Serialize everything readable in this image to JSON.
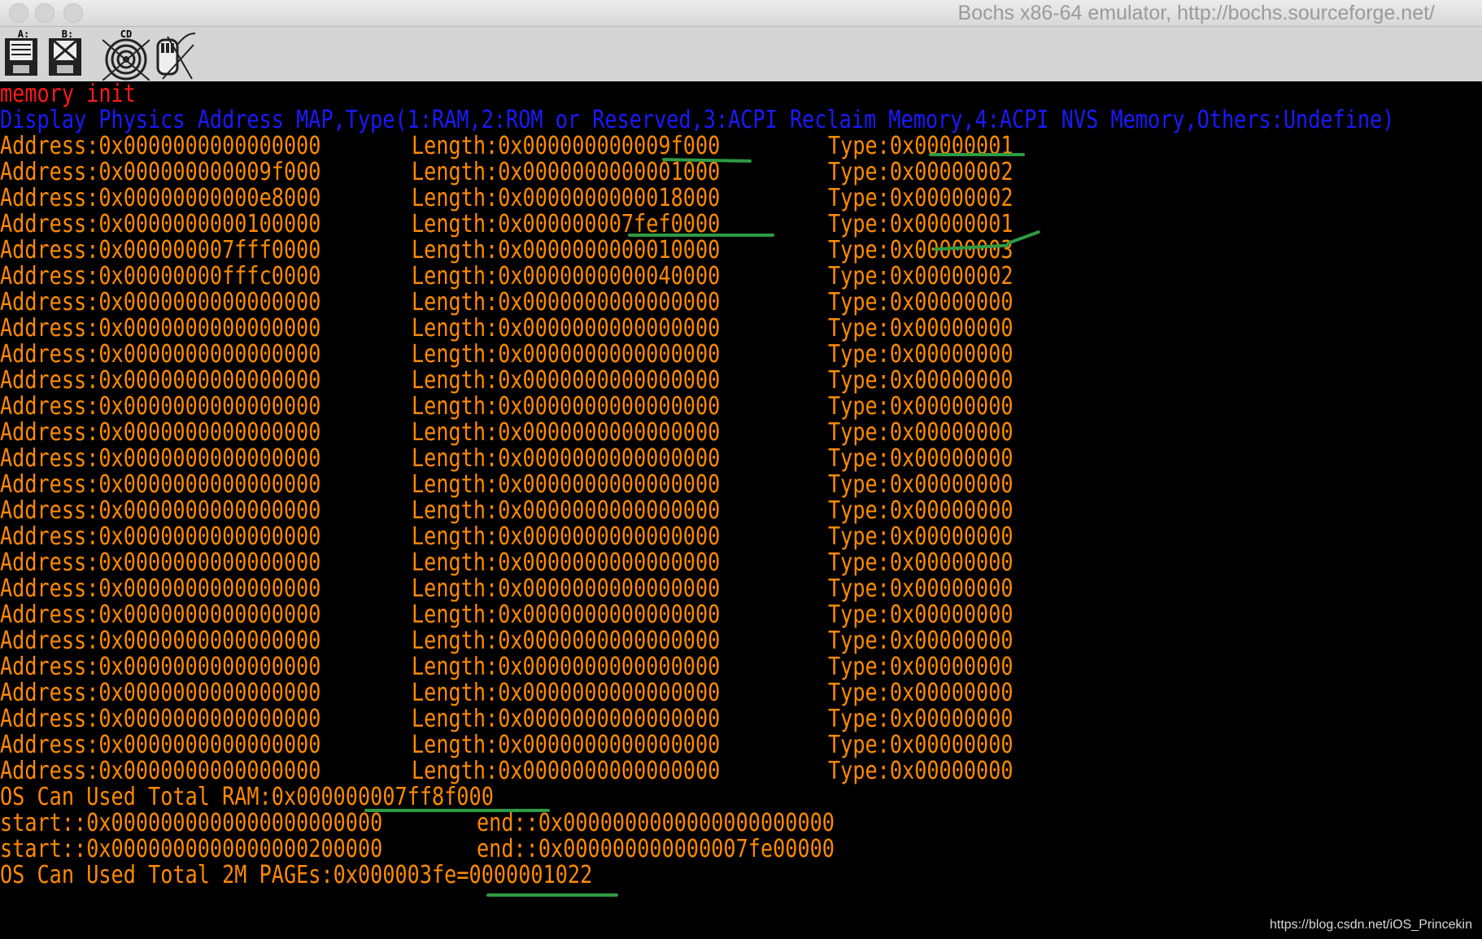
{
  "window": {
    "title": "Bochs x86-64 emulator, http://bochs.sourceforge.net/"
  },
  "toolbar": {
    "buttons": [
      {
        "label": "A:",
        "icon": "floppy-a-icon"
      },
      {
        "label": "B:",
        "icon": "floppy-b-icon"
      },
      {
        "label": "CD",
        "icon": "cdrom-icon"
      },
      {
        "label": "",
        "icon": "mouse-icon"
      }
    ]
  },
  "console": {
    "header1": "memory init",
    "header2": "Display Physics Address MAP,Type(1:RAM,2:ROM or Reserved,3:ACPI Reclaim Memory,4:ACPI NVS Memory,Others:Undefine)",
    "rows": [
      {
        "address": "Address:0x0000000000000000",
        "length": "Length:0x000000000009f000",
        "type": "Type:0x00000001"
      },
      {
        "address": "Address:0x000000000009f000",
        "length": "Length:0x0000000000001000",
        "type": "Type:0x00000002"
      },
      {
        "address": "Address:0x00000000000e8000",
        "length": "Length:0x0000000000018000",
        "type": "Type:0x00000002"
      },
      {
        "address": "Address:0x0000000000100000",
        "length": "Length:0x000000007fef0000",
        "type": "Type:0x00000001"
      },
      {
        "address": "Address:0x000000007fff0000",
        "length": "Length:0x0000000000010000",
        "type": "Type:0x00000003"
      },
      {
        "address": "Address:0x00000000fffc0000",
        "length": "Length:0x0000000000040000",
        "type": "Type:0x00000002"
      },
      {
        "address": "Address:0x0000000000000000",
        "length": "Length:0x0000000000000000",
        "type": "Type:0x00000000"
      },
      {
        "address": "Address:0x0000000000000000",
        "length": "Length:0x0000000000000000",
        "type": "Type:0x00000000"
      },
      {
        "address": "Address:0x0000000000000000",
        "length": "Length:0x0000000000000000",
        "type": "Type:0x00000000"
      },
      {
        "address": "Address:0x0000000000000000",
        "length": "Length:0x0000000000000000",
        "type": "Type:0x00000000"
      },
      {
        "address": "Address:0x0000000000000000",
        "length": "Length:0x0000000000000000",
        "type": "Type:0x00000000"
      },
      {
        "address": "Address:0x0000000000000000",
        "length": "Length:0x0000000000000000",
        "type": "Type:0x00000000"
      },
      {
        "address": "Address:0x0000000000000000",
        "length": "Length:0x0000000000000000",
        "type": "Type:0x00000000"
      },
      {
        "address": "Address:0x0000000000000000",
        "length": "Length:0x0000000000000000",
        "type": "Type:0x00000000"
      },
      {
        "address": "Address:0x0000000000000000",
        "length": "Length:0x0000000000000000",
        "type": "Type:0x00000000"
      },
      {
        "address": "Address:0x0000000000000000",
        "length": "Length:0x0000000000000000",
        "type": "Type:0x00000000"
      },
      {
        "address": "Address:0x0000000000000000",
        "length": "Length:0x0000000000000000",
        "type": "Type:0x00000000"
      },
      {
        "address": "Address:0x0000000000000000",
        "length": "Length:0x0000000000000000",
        "type": "Type:0x00000000"
      },
      {
        "address": "Address:0x0000000000000000",
        "length": "Length:0x0000000000000000",
        "type": "Type:0x00000000"
      },
      {
        "address": "Address:0x0000000000000000",
        "length": "Length:0x0000000000000000",
        "type": "Type:0x00000000"
      },
      {
        "address": "Address:0x0000000000000000",
        "length": "Length:0x0000000000000000",
        "type": "Type:0x00000000"
      },
      {
        "address": "Address:0x0000000000000000",
        "length": "Length:0x0000000000000000",
        "type": "Type:0x00000000"
      },
      {
        "address": "Address:0x0000000000000000",
        "length": "Length:0x0000000000000000",
        "type": "Type:0x00000000"
      },
      {
        "address": "Address:0x0000000000000000",
        "length": "Length:0x0000000000000000",
        "type": "Type:0x00000000"
      },
      {
        "address": "Address:0x0000000000000000",
        "length": "Length:0x0000000000000000",
        "type": "Type:0x00000000"
      }
    ],
    "total_ram": "OS Can Used Total RAM:0x000000007ff8f000",
    "ranges": [
      {
        "start": "start::0x0000000000000000000000",
        "end": "end::0x0000000000000000000000"
      },
      {
        "start": "start::0x0000000000000000200000",
        "end": "end::0x000000000000007fe00000"
      }
    ],
    "total_pages": "OS Can Used Total 2M PAGEs:0x000003fe=0000001022"
  },
  "colors": {
    "header1": "#ff1a1a",
    "header2": "#1a1aff",
    "text": "#ff8a00",
    "annotation": "#2f9a44"
  },
  "watermark": "https://blog.csdn.net/iOS_Princekin"
}
